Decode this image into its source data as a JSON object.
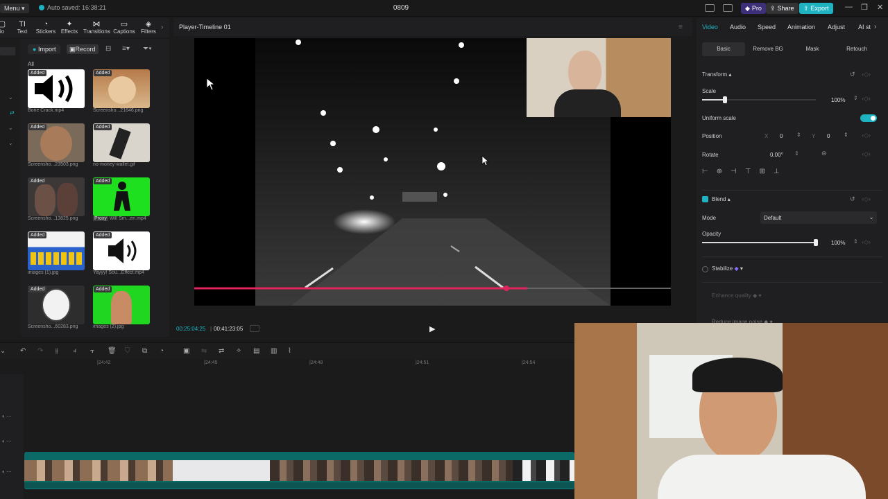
{
  "titlebar": {
    "menu_label": "Menu",
    "autosave": "Auto saved: 16:38:21",
    "project_name": "0809",
    "pro_label": "Pro",
    "share_label": "Share",
    "export_label": "Export"
  },
  "tools": [
    {
      "label": "io",
      "icon": "media-icon"
    },
    {
      "label": "Text",
      "icon": "text-icon"
    },
    {
      "label": "Stickers",
      "icon": "sticker-icon"
    },
    {
      "label": "Effects",
      "icon": "effects-icon"
    },
    {
      "label": "Transitions",
      "icon": "transition-icon"
    },
    {
      "label": "Captions",
      "icon": "captions-icon"
    },
    {
      "label": "Filters",
      "icon": "filters-icon"
    }
  ],
  "media": {
    "import_label": "Import",
    "record_label": "Record",
    "all_label": "All",
    "items": [
      {
        "badge": "Added",
        "name": "Bone Crack.mp4"
      },
      {
        "badge": "Added",
        "name": "Screensho...21646.png"
      },
      {
        "badge": "Added",
        "name": "Screensho...23503.png"
      },
      {
        "badge": "Added",
        "name": "no-money-wallet.gif"
      },
      {
        "badge": "Added",
        "name": "Screensho...13825.png"
      },
      {
        "badge": "Added",
        "name": "Will Sm...en.mp4",
        "proxy": "Proxy"
      },
      {
        "badge": "Added",
        "name": "images (1).jpg"
      },
      {
        "badge": "Added",
        "name": "Yayyy! Sou...Effect.mp4"
      },
      {
        "badge": "Added",
        "name": "Screensho...60283.png"
      },
      {
        "badge": "Added",
        "name": "images (2).jpg"
      }
    ]
  },
  "player": {
    "title": "Player-Timeline 01",
    "current_time": "00:25:04:25",
    "total_time": "00:41:23:05"
  },
  "right_panel": {
    "tabs": [
      "Video",
      "Audio",
      "Speed",
      "Animation",
      "Adjust",
      "AI st"
    ],
    "subtabs": [
      "Basic",
      "Remove BG",
      "Mask",
      "Retouch"
    ],
    "transform_label": "Transform",
    "scale_label": "Scale",
    "scale_value": "100%",
    "scale_fraction": 0.2,
    "uniform_scale_label": "Uniform scale",
    "position_label": "Position",
    "pos_x_label": "X",
    "pos_x": "0",
    "pos_y_label": "Y",
    "pos_y": "0",
    "rotate_label": "Rotate",
    "rotate_value": "0.00°",
    "blend_label": "Blend",
    "mode_label": "Mode",
    "mode_value": "Default",
    "opacity_label": "Opacity",
    "opacity_value": "100%",
    "opacity_fraction": 1.0,
    "stabilize_label": "Stabilize",
    "enhance_label": "Enhance quality",
    "reduce_noise_label": "Reduce image noise"
  },
  "timeline": {
    "ruler": [
      "|24:42",
      "|24:45",
      "|24:48",
      "|24:51",
      "|24:54"
    ]
  },
  "colors": {
    "accent": "#1fb3c2",
    "playhead": "#e0245e",
    "export_bg": "#1fb3c2",
    "pro_bg": "#5b3fd6"
  }
}
